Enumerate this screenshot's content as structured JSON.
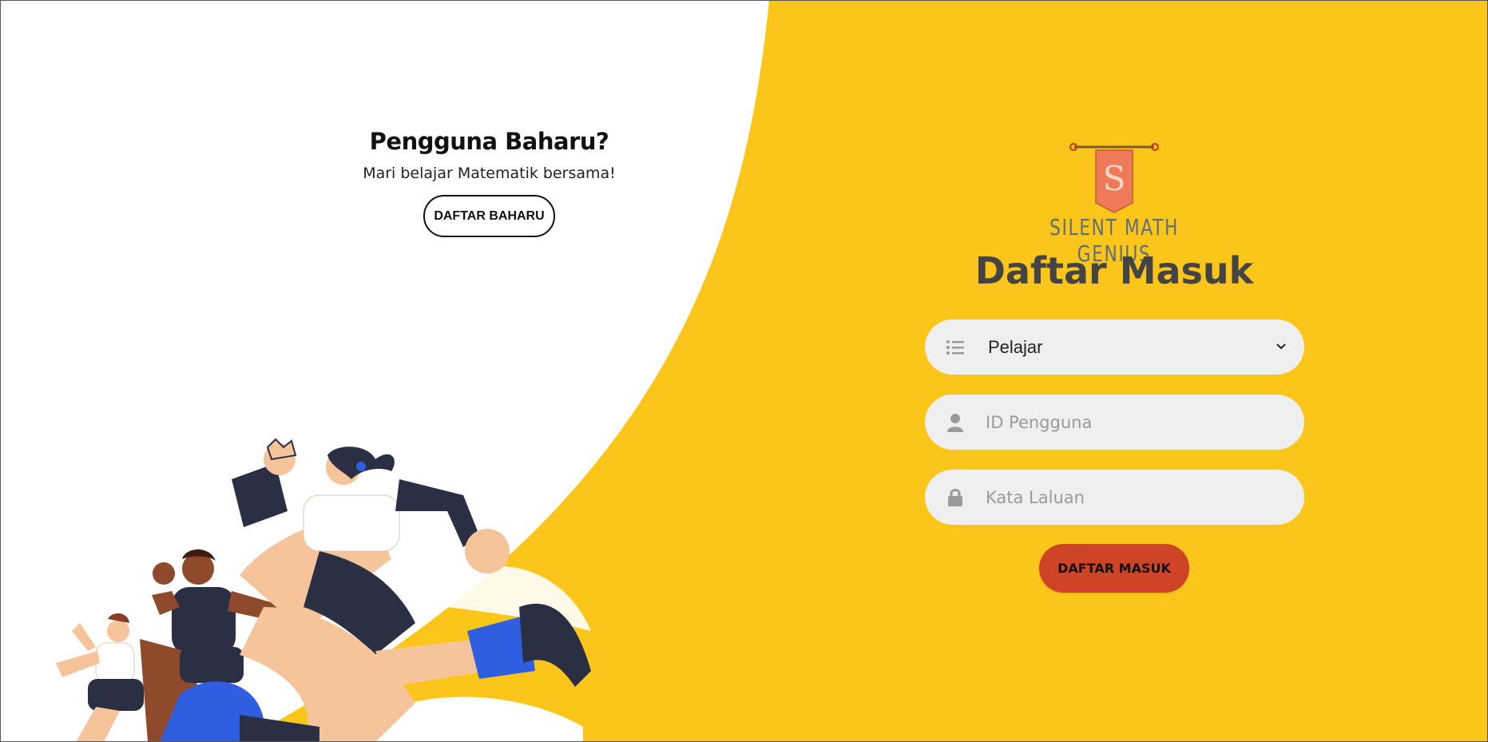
{
  "signup_panel": {
    "title": "Pengguna Baharu?",
    "subtitle": "Mari belajar Matematik bersama!",
    "signup_button": "DAFTAR BAHARU"
  },
  "brand": {
    "name": "SILENT MATH GENIUS",
    "banner_letter": "S"
  },
  "login_form": {
    "title": "Daftar Masuk",
    "role_select": {
      "value": "Pelajar",
      "icon": "list-icon"
    },
    "user_id": {
      "placeholder": "ID Pengguna",
      "icon": "user-icon"
    },
    "password": {
      "placeholder": "Kata Laluan",
      "icon": "lock-icon"
    },
    "login_button": "DAFTAR MASUK"
  },
  "colors": {
    "background_accent": "#fbc519",
    "login_button": "#cf4426",
    "field_background": "#efefef",
    "banner": "#ee7a57"
  }
}
